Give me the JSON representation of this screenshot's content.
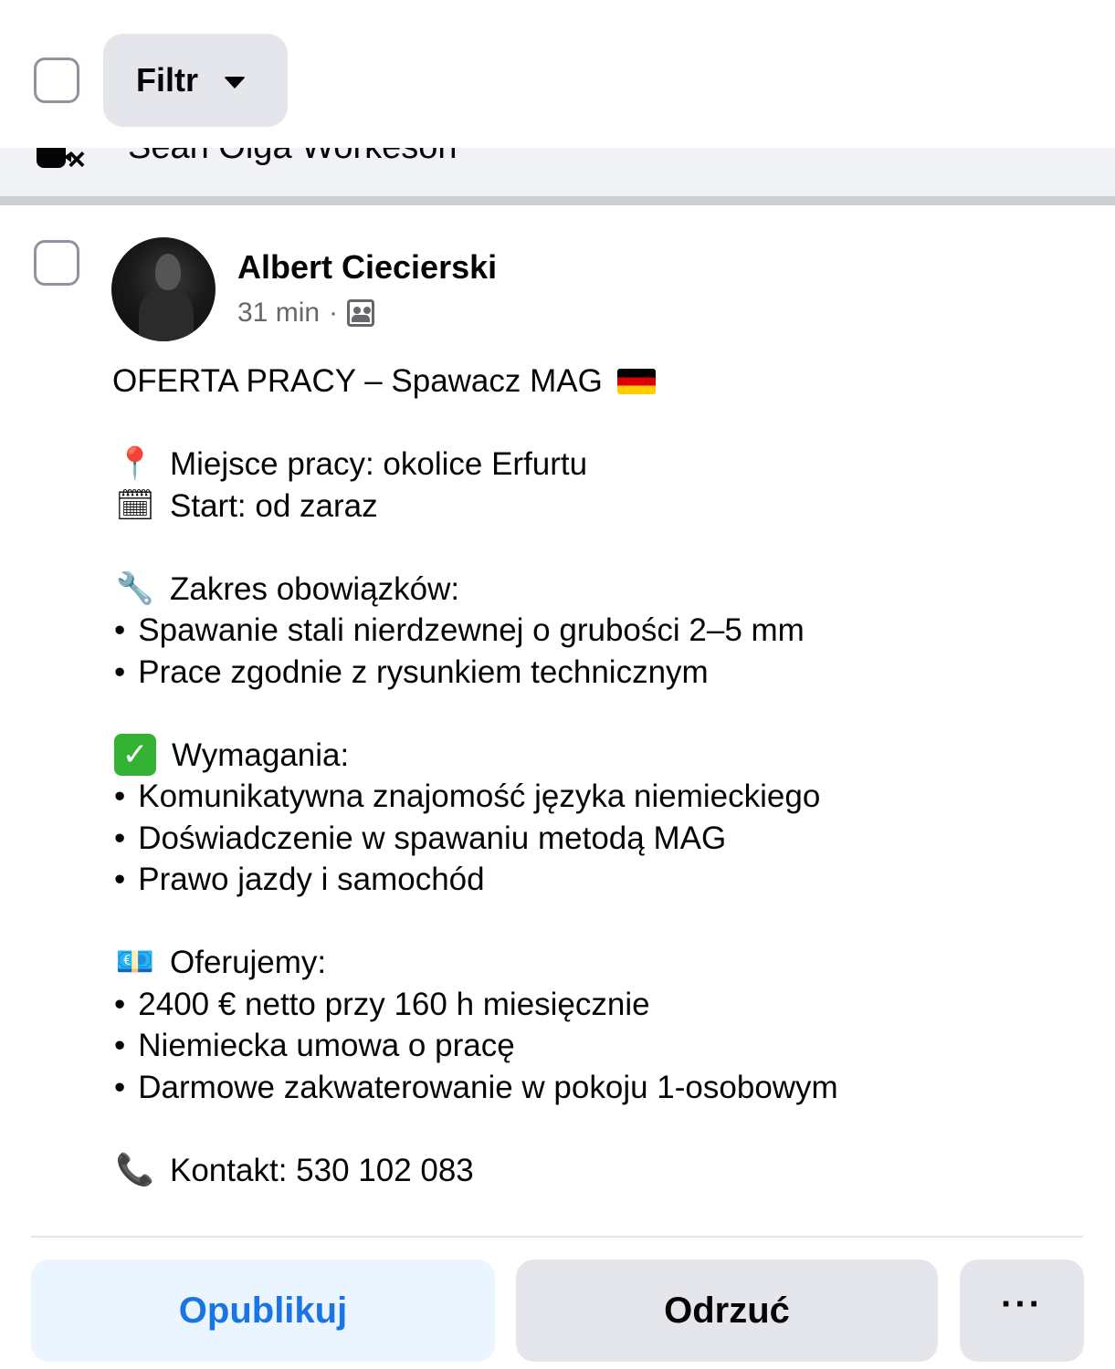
{
  "topbar": {
    "filter_label": "Filtr"
  },
  "previous_row": {
    "cut_text": "Sean Olga Workeson"
  },
  "post": {
    "author": "Albert Ciecierski",
    "time": "31 min",
    "meta_separator": "·",
    "privacy_icon": "group-icon",
    "lines": {
      "title": "OFERTA PRACY – Spawacz MAG",
      "location": "Miejsce pracy: okolice Erfurtu",
      "start": "Start: od zaraz",
      "duties_header": "Zakres obowiązków:",
      "duty_1": "Spawanie stali nierdzewnej o grubości 2–5 mm",
      "duty_2": "Prace zgodnie z rysunkiem technicznym",
      "requirements_header": "Wymagania:",
      "req_1": "Komunikatywna znajomość języka niemieckiego",
      "req_2": "Doświadczenie w spawaniu metodą MAG",
      "req_3": "Prawo jazdy i samochód",
      "offer_header": "Oferujemy:",
      "offer_1": "2400 € netto przy 160 h miesięcznie",
      "offer_2": "Niemiecka umowa o pracę",
      "offer_3": "Darmowe zakwaterowanie w pokoju 1-osobowym",
      "contact": "Kontakt: 530 102 083"
    },
    "bullet": "•",
    "emojis": {
      "pin": "📍",
      "calendar": "🗓",
      "wrench": "🔧",
      "check": "✓",
      "money": "💶",
      "phone": "📞"
    }
  },
  "actions": {
    "publish_label": "Opublikuj",
    "reject_label": "Odrzuć",
    "more_label": "···"
  },
  "colors": {
    "publish_text": "#1b74e4",
    "publish_bg": "#ebf5ff",
    "secondary_bg": "#e4e6eb",
    "meta_text": "#65676b"
  }
}
